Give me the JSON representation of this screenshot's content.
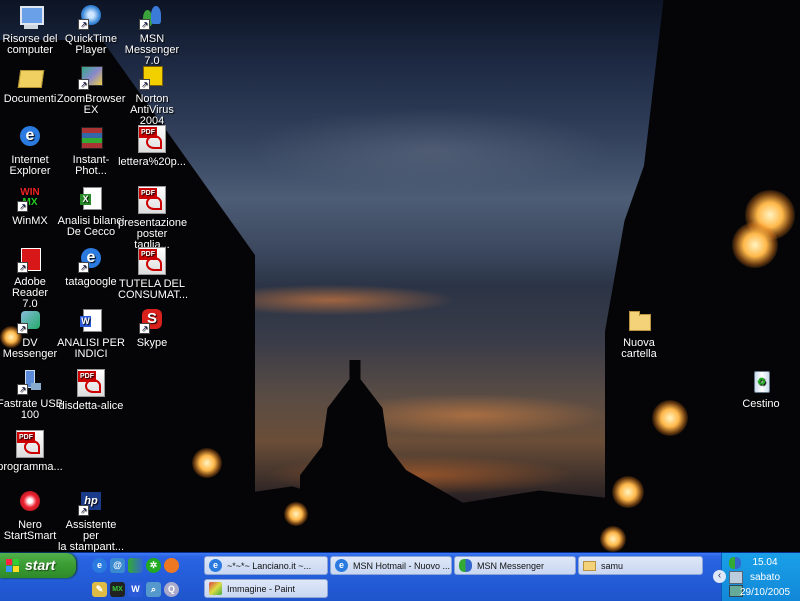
{
  "desktop_icons": [
    {
      "id": "risorse",
      "label": "Risorse del\ncomputer",
      "icon": "my-computer-icon"
    },
    {
      "id": "quicktime",
      "label": "QuickTime\nPlayer",
      "icon": "quicktime-icon"
    },
    {
      "id": "msn",
      "label": "MSN\nMessenger 7.0",
      "icon": "msn-messenger-icon"
    },
    {
      "id": "documenti",
      "label": "Documenti",
      "icon": "my-documents-icon"
    },
    {
      "id": "zoombrowser",
      "label": "ZoomBrowser\nEX",
      "icon": "zoombrowser-icon"
    },
    {
      "id": "norton",
      "label": "Norton\nAntiVirus 2004",
      "icon": "norton-antivirus-icon"
    },
    {
      "id": "ie",
      "label": "Internet\nExplorer",
      "icon": "internet-explorer-icon"
    },
    {
      "id": "instantphoto",
      "label": "Instant-Phot...",
      "icon": "winrar-archive-icon"
    },
    {
      "id": "lettera",
      "label": "lettera%20p...",
      "icon": "pdf-file-icon"
    },
    {
      "id": "winmx",
      "label": "WinMX",
      "icon": "winmx-icon"
    },
    {
      "id": "analisi",
      "label": "Analisi bilanci\nDe Cecco",
      "icon": "excel-file-icon"
    },
    {
      "id": "presentazione",
      "label": "presentazione\nposter taglia...",
      "icon": "pdf-file-icon"
    },
    {
      "id": "adobe",
      "label": "Adobe Reader\n7.0",
      "icon": "adobe-reader-icon"
    },
    {
      "id": "tatagoogle",
      "label": "tatagoogle",
      "icon": "internet-shortcut-icon"
    },
    {
      "id": "tutela",
      "label": "TUTELA DEL\nCONSUMAT...",
      "icon": "pdf-file-icon"
    },
    {
      "id": "dvmessenger",
      "label": "DV Messenger",
      "icon": "dv-messenger-icon"
    },
    {
      "id": "analisiper",
      "label": "ANALISI PER\nINDICI",
      "icon": "word-file-icon"
    },
    {
      "id": "skype",
      "label": "Skype",
      "icon": "skype-icon"
    },
    {
      "id": "fastrate",
      "label": "Fastrate USB\n100",
      "icon": "usb-modem-icon"
    },
    {
      "id": "disdetta",
      "label": "disdetta-alice",
      "icon": "pdf-file-icon"
    },
    {
      "id": "programma",
      "label": "programma...",
      "icon": "pdf-file-icon"
    },
    {
      "id": "nero",
      "label": "Nero\nStartSmart",
      "icon": "nero-icon"
    },
    {
      "id": "assistente",
      "label": "Assistente per\nla stampant...",
      "icon": "hp-printer-icon"
    },
    {
      "id": "nuovacartella",
      "label": "Nuova cartella",
      "icon": "folder-icon"
    },
    {
      "id": "cestino",
      "label": "Cestino",
      "icon": "recycle-bin-icon"
    }
  ],
  "taskbar": {
    "start_label": "start",
    "quick_launch": [
      "internet-explorer-icon",
      "outlook-icon",
      "msn-icon",
      "winamp-icon",
      "firefox-icon",
      "pencil-icon",
      "winmx-icon",
      "word-icon",
      "search-icon",
      "qt-icon"
    ],
    "buttons": [
      {
        "label": "~*~*~ Lanciano.it ~...",
        "icon": "internet-explorer-icon"
      },
      {
        "label": "MSN Hotmail - Nuovo ...",
        "icon": "internet-explorer-icon"
      },
      {
        "label": "MSN Messenger",
        "icon": "msn-messenger-icon"
      },
      {
        "label": "samu",
        "icon": "folder-icon"
      },
      {
        "label": "Immagine - Paint",
        "icon": "paint-icon"
      }
    ]
  },
  "tray": {
    "time": "15.04",
    "day": "sabato",
    "date": "29/10/2005"
  },
  "colors": {
    "taskbar": "#245dd9",
    "start_button": "#3a9b33",
    "tray": "#1288d8"
  }
}
